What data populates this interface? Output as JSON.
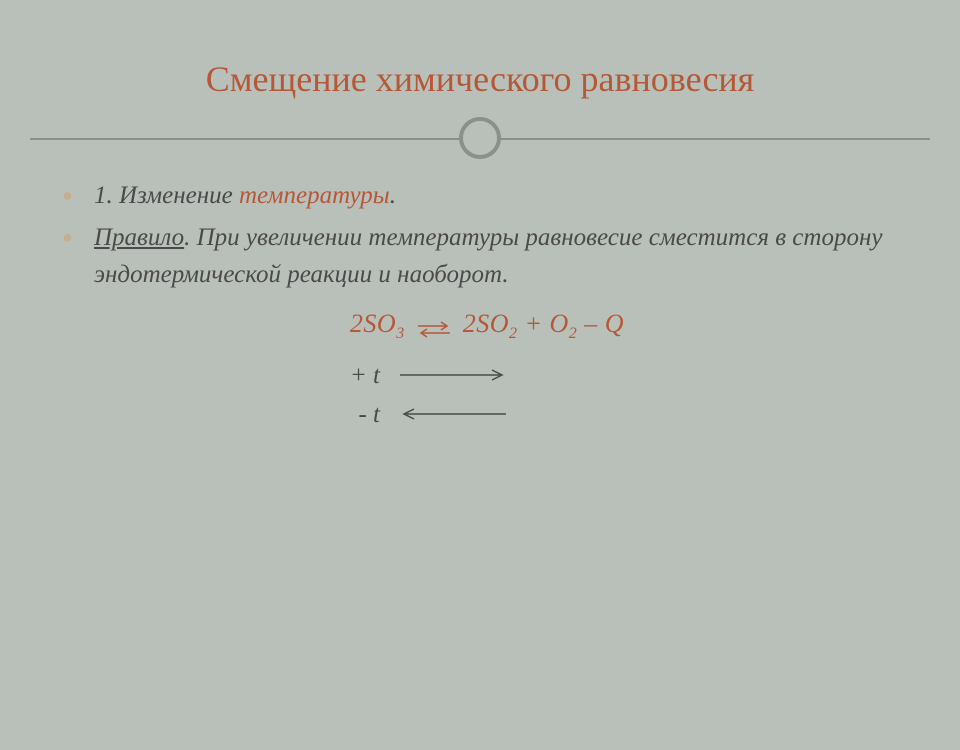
{
  "title": "Смещение химического равновесия",
  "bullet1_prefix": "1. Изменение ",
  "bullet1_highlight": "температуры",
  "bullet1_suffix": ".",
  "bullet2_underline": "Правило",
  "bullet2_rest": ". При увеличении температуры равновесие сместится в сторону эндотермической реакции и наоборот.",
  "equation": {
    "left": "2SO",
    "left_sub": "3",
    "right_a": "2SO",
    "right_a_sub": "2",
    "plus1": " + O",
    "o_sub": "2",
    "tail": " – Q"
  },
  "temp_plus": "+ t",
  "temp_minus": "- t"
}
